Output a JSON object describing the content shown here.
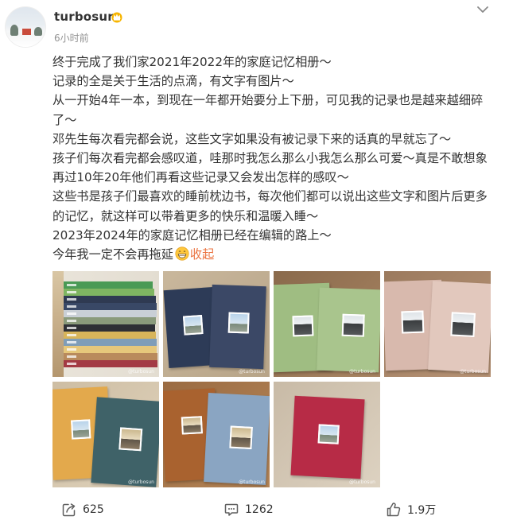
{
  "user": {
    "name": "turbosun",
    "timestamp": "6小时前",
    "badge_icon": "crown-icon"
  },
  "post": {
    "lines": [
      "终于完成了我们家2021年2022年的家庭记忆相册～",
      "记录的全是关于生活的点滴，有文字有图片～",
      "从一开始4年一本，到现在一年都开始要分上下册，可见我的记录也是越来越细碎",
      "了～",
      "邓先生每次看完都会说，这些文字如果没有被记录下来的话真的早就忘了～",
      "孩子们每次看完都会感叹道，哇那时我怎么那么小我怎么那么可爱～真是不敢想象",
      "再过10年20年他们再看这些记录又会发出怎样的感叹～",
      "这些书是孩子们最喜欢的睡前枕边书，每次他们都可以说出这些文字和图片后更多",
      "的记忆，就这样可以带着更多的快乐和温暖入睡～",
      "2023年2024年的家庭记忆相册已经在编辑的路上～",
      "今年我一定不会再拖延"
    ],
    "emoji_icon": "grinning-face-icon",
    "collapse_label": "收起",
    "link_color": "#eb7340"
  },
  "photos": [
    {
      "id": "stack-of-albums",
      "colors": [
        "#4a9a55",
        "#7fb562",
        "#2f3a52",
        "#394866",
        "#c9cfd6",
        "#8a9a7b",
        "#2e2f35",
        "#d8b45a",
        "#7f9db8",
        "#e6c77b",
        "#b98a5c",
        "#a33a44"
      ]
    },
    {
      "id": "navy-albums",
      "colors": [
        "#2d3b57",
        "#3b4866"
      ]
    },
    {
      "id": "green-albums",
      "colors": [
        "#9fbd82",
        "#a9c58d"
      ]
    },
    {
      "id": "pink-albums",
      "colors": [
        "#d8b9ad",
        "#e2c8bd"
      ]
    },
    {
      "id": "yellow-teal-albums",
      "colors": [
        "#e3a94c",
        "#3f6268"
      ]
    },
    {
      "id": "brown-blue-albums",
      "colors": [
        "#a9622f",
        "#8aa5c2"
      ]
    },
    {
      "id": "red-album",
      "colors": [
        "#b72b46"
      ]
    }
  ],
  "watermark": "@turbosun",
  "actions": {
    "repost_count": "625",
    "comment_count": "1262",
    "like_count": "1.9万"
  }
}
